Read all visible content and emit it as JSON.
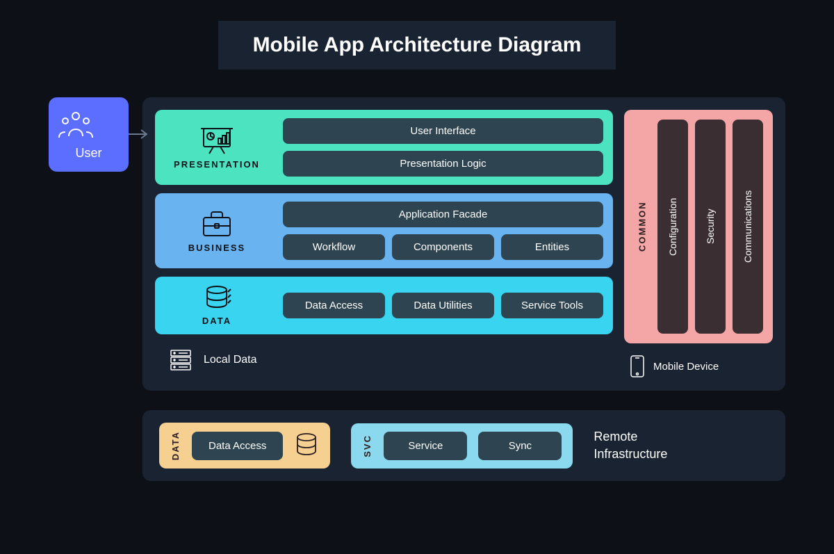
{
  "title": "Mobile App Architecture Diagram",
  "user": {
    "label": "User"
  },
  "presentation": {
    "label": "PRESENTATION",
    "ui": "User Interface",
    "logic": "Presentation Logic"
  },
  "business": {
    "label": "BUSINESS",
    "facade": "Application Facade",
    "workflow": "Workflow",
    "components": "Components",
    "entities": "Entities"
  },
  "data": {
    "label": "DATA",
    "access": "Data Access",
    "utilities": "Data Utilities",
    "tools": "Service Tools"
  },
  "local": {
    "label": "Local Data"
  },
  "common": {
    "label": "COMMON",
    "config": "Configuration",
    "security": "Security",
    "comms": "Communications"
  },
  "device": {
    "label": "Mobile Device"
  },
  "remote": {
    "data_label": "DATA",
    "data_access": "Data Access",
    "svc_label": "SVC",
    "service": "Service",
    "sync": "Sync",
    "title": "Remote Infrastructure"
  }
}
